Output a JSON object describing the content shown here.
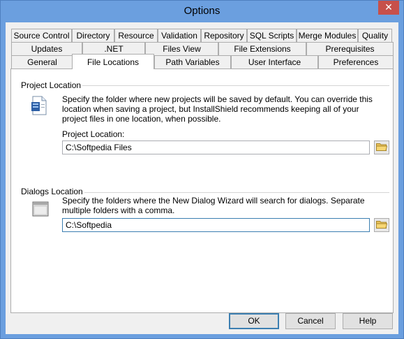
{
  "window": {
    "title": "Options",
    "close_glyph": "✕"
  },
  "tabs": {
    "row1": [
      "Source Control",
      "Directory",
      "Resource",
      "Validation",
      "Repository",
      "SQL Scripts",
      "Merge Modules",
      "Quality"
    ],
    "row2": [
      "Updates",
      ".NET",
      "Files View",
      "File Extensions",
      "Prerequisites"
    ],
    "row3": [
      "General",
      "File Locations",
      "Path Variables",
      "User Interface",
      "Preferences"
    ],
    "active": "File Locations"
  },
  "project": {
    "section_title": "Project Location",
    "description": "Specify the folder where new projects will be saved by default. You can override this location when saving a project, but InstallShield recommends keeping all of your project files in one location, when possible.",
    "field_label": "Project Location:",
    "value": "C:\\Softpedia Files",
    "icon": "project-document-icon"
  },
  "dialogs": {
    "section_title": "Dialogs Location",
    "description": "Specify the folders where the New Dialog Wizard will search for dialogs. Separate multiple folders with a comma.",
    "value": "C:\\Softpedia",
    "icon": "dialog-window-icon"
  },
  "buttons": {
    "ok": "OK",
    "cancel": "Cancel",
    "help": "Help"
  },
  "colors": {
    "titlebar": "#6B9FDF",
    "close": "#C7504A",
    "focus_border": "#3C7FB1"
  }
}
